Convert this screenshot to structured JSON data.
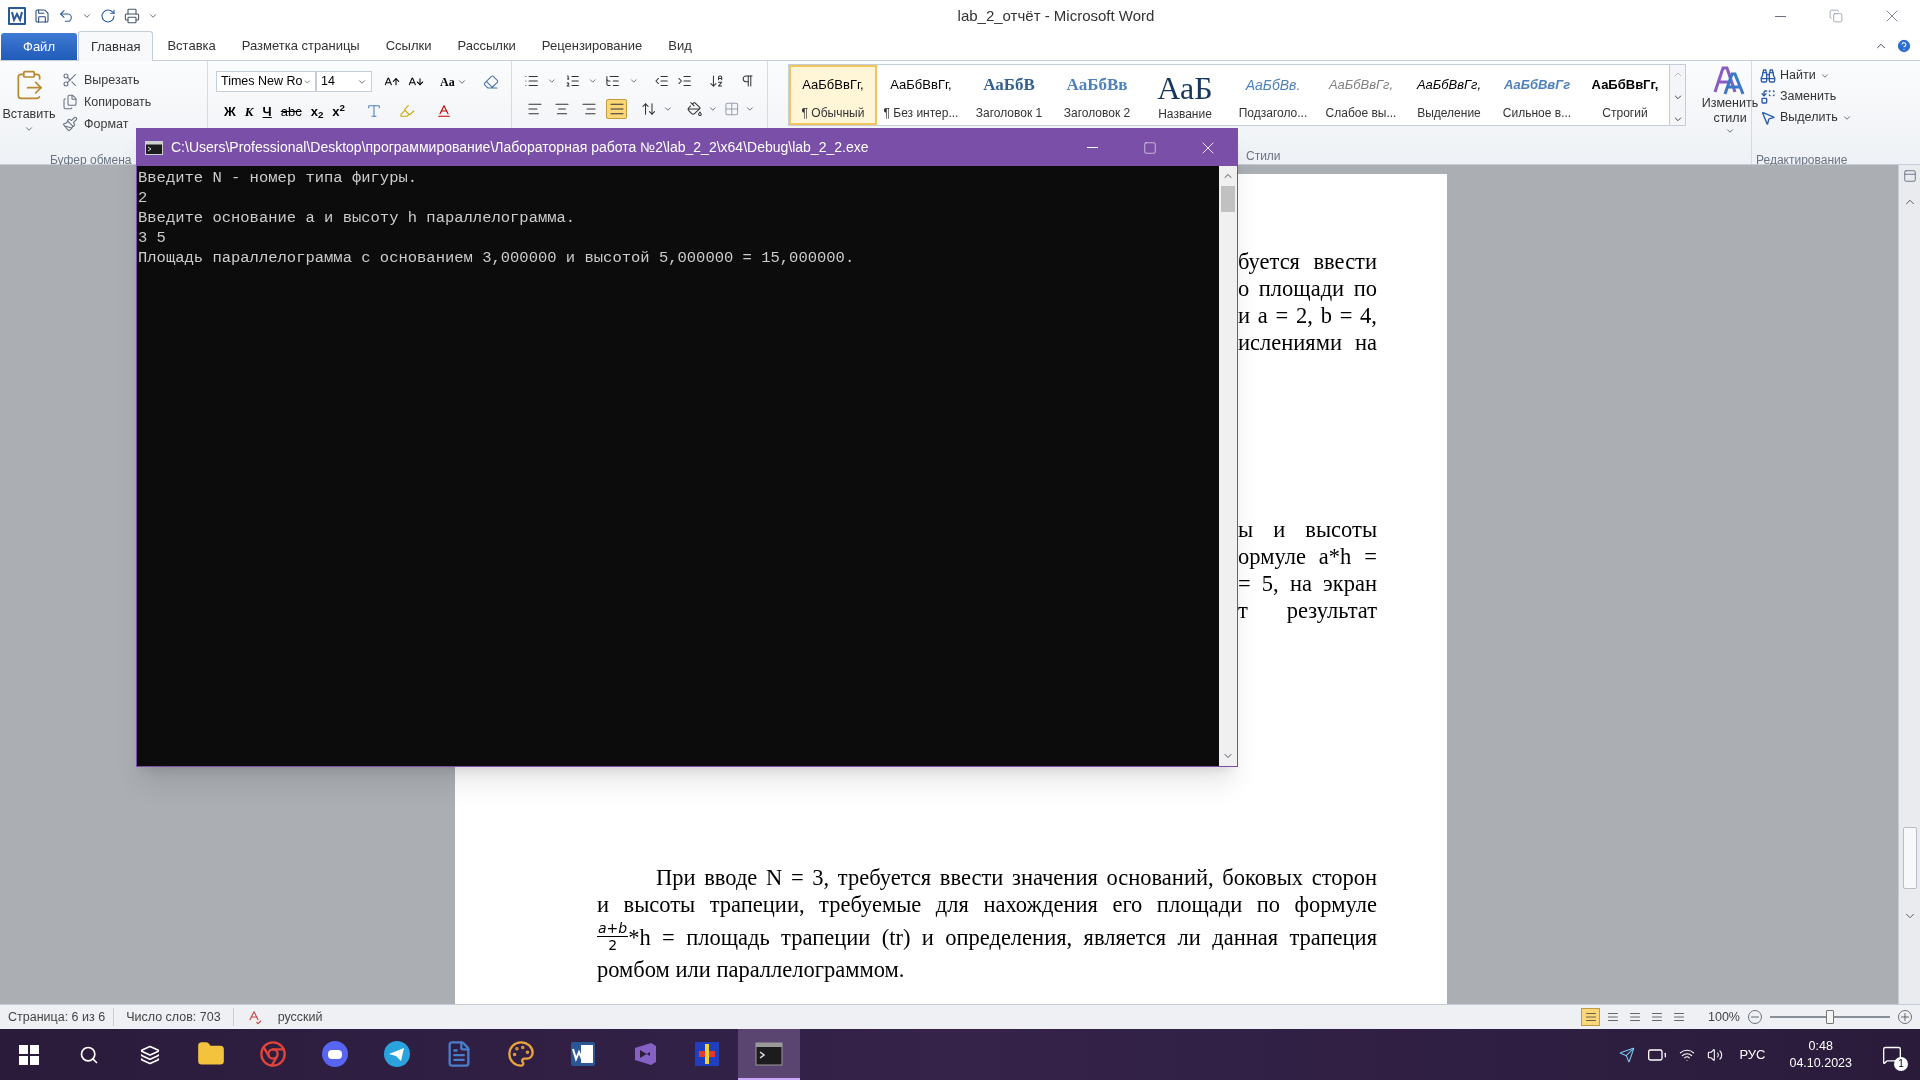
{
  "window": {
    "title": "lab_2_отчёт - Microsoft Word"
  },
  "ribbon_tabs": [
    {
      "label": "Файл",
      "kind": "file",
      "selected": false
    },
    {
      "label": "Главная",
      "kind": "tab",
      "selected": true
    },
    {
      "label": "Вставка",
      "kind": "tab",
      "selected": false
    },
    {
      "label": "Разметка страницы",
      "kind": "tab",
      "selected": false
    },
    {
      "label": "Ссылки",
      "kind": "tab",
      "selected": false
    },
    {
      "label": "Рассылки",
      "kind": "tab",
      "selected": false
    },
    {
      "label": "Рецензирование",
      "kind": "tab",
      "selected": false
    },
    {
      "label": "Вид",
      "kind": "tab",
      "selected": false
    }
  ],
  "clipboard": {
    "paste": "Вставить",
    "cut": "Вырезать",
    "copy": "Копировать",
    "format": "Формат",
    "group_label": "Буфер обмена"
  },
  "font": {
    "name": "Times New Ro",
    "size": "14",
    "case_button": "Aa",
    "style_buttons": [
      {
        "label": "Ж",
        "kind": "bold"
      },
      {
        "label": "К",
        "kind": "italic"
      },
      {
        "label": "Ч",
        "kind": "underline"
      },
      {
        "label": "abc",
        "kind": "strike"
      },
      {
        "label": "x$_{2}$",
        "kind": "plain"
      },
      {
        "label": "x$^{2}$",
        "kind": "plain"
      }
    ]
  },
  "paragraph": {
    "alignment": [
      {
        "kind": "left",
        "selected": false
      },
      {
        "kind": "center",
        "selected": false
      },
      {
        "kind": "right",
        "selected": false
      },
      {
        "kind": "justify",
        "selected": true
      }
    ]
  },
  "styles": {
    "items": [
      {
        "preview": "АаБбВвГг,",
        "label": "¶ Обычный",
        "kind": "normal",
        "selected": true
      },
      {
        "preview": "АаБбВвГг,",
        "label": "¶ Без интер...",
        "kind": "normal",
        "selected": false
      },
      {
        "preview": "АаБбВ",
        "label": "Заголовок 1",
        "kind": "heading1",
        "selected": false
      },
      {
        "preview": "АаБбВв",
        "label": "Заголовок 2",
        "kind": "heading2",
        "selected": false
      },
      {
        "preview": "АаБ",
        "label": "Название",
        "kind": "title",
        "selected": false
      },
      {
        "preview": "АаБбВв.",
        "label": "Подзаголо...",
        "kind": "subtitle",
        "selected": false
      },
      {
        "preview": "АаБбВвГг,",
        "label": "Слабое вы...",
        "kind": "subtle",
        "selected": false
      },
      {
        "preview": "АаБбВвГг,",
        "label": "Выделение",
        "kind": "emphasis",
        "selected": false
      },
      {
        "preview": "АаБбВвГг",
        "label": "Сильное в...",
        "kind": "intense",
        "selected": false
      },
      {
        "preview": "АаБбВвГг,",
        "label": "Строгий",
        "kind": "strong",
        "selected": false
      }
    ],
    "change_styles": "Изменить стили",
    "group_label": "Стили"
  },
  "editing": {
    "find": "Найти",
    "replace": "Заменить",
    "select": "Выделить",
    "group_label": "Редактирование"
  },
  "document": {
    "fragments_top": [
      "буется ввести",
      "о площади по",
      "и a = 2, b = 4,",
      "ислениями на"
    ],
    "fragments_middle": [
      "ы и высоты",
      "ормуле a*h =",
      "= 5, на экран",
      "т результат"
    ],
    "paragraph": {
      "line_1": "При вводе N = 3, требуется ввести значения оснований, боковых сторон",
      "line_2": "и высоты трапеции, требуемые для нахождения его площади по формуле",
      "numerator": "a+b",
      "denominator": "2",
      "line_3": "*h = площадь трапеции (tr) и определения, является ли данная трапеция",
      "line_4": "ромбом или параллелограммом."
    }
  },
  "console": {
    "title": "C:\\Users\\Professional\\Desktop\\программирование\\Лабораторная работа №2\\lab_2_2\\x64\\Debug\\lab_2_2.exe",
    "lines": [
      "Введите N - номер типа фигуры.",
      "2",
      "Введите основание a и высоту h параллелограмма.",
      "3 5",
      "Площадь параллелограмма с основанием 3,000000 и высотой 5,000000 = 15,000000."
    ]
  },
  "status_bar": {
    "page": "Страница: 6 из 6",
    "words": "Число слов: 703",
    "language": "русский",
    "views": [
      {
        "selected": true
      },
      {
        "selected": false
      },
      {
        "selected": false
      },
      {
        "selected": false
      },
      {
        "selected": false
      }
    ],
    "zoom": "100%",
    "zoom_slider": {
      "level": 0.5
    }
  },
  "taskbar": {
    "apps": [
      {
        "kind": "folder",
        "selected": false
      },
      {
        "kind": "browser",
        "selected": false
      },
      {
        "kind": "chat",
        "selected": false
      },
      {
        "kind": "messenger",
        "selected": false
      },
      {
        "kind": "document",
        "selected": false
      },
      {
        "kind": "palette",
        "selected": false
      },
      {
        "kind": "word",
        "selected": false
      },
      {
        "kind": "studio",
        "selected": false
      },
      {
        "kind": "tool",
        "selected": false
      },
      {
        "kind": "console",
        "selected": true
      }
    ],
    "language": "РУС",
    "time": "0:48",
    "date": "04.10.2023",
    "notifications": "1"
  }
}
